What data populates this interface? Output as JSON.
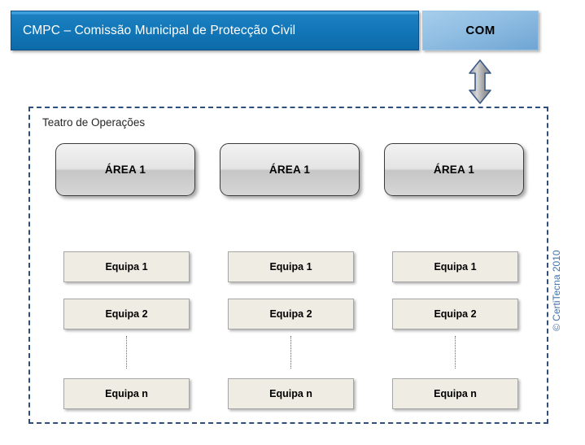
{
  "header": {
    "title_bar_label": "CMPC – Comissão Municipal de Protecção Civil",
    "com_label": "COM",
    "link_arrow_icon": "double-vertical-arrow-icon",
    "title_bar_color": "#1277b8",
    "com_color": "#8fbde2"
  },
  "theatre": {
    "label": "Teatro de Operações",
    "border_color": "#2e4f7c",
    "areas": [
      {
        "label": "ÁREA 1"
      },
      {
        "label": "ÁREA 1"
      },
      {
        "label": "ÁREA 1"
      }
    ],
    "columns": [
      {
        "teams": [
          {
            "label": "Equipa 1"
          },
          {
            "label": "Equipa 2"
          },
          {
            "label": "Equipa n"
          }
        ]
      },
      {
        "teams": [
          {
            "label": "Equipa 1"
          },
          {
            "label": "Equipa 2"
          },
          {
            "label": "Equipa n"
          }
        ]
      },
      {
        "teams": [
          {
            "label": "Equipa 1"
          },
          {
            "label": "Equipa 2"
          },
          {
            "label": "Equipa n"
          }
        ]
      }
    ]
  },
  "footer": {
    "copyright": "© CertiTecna  2010",
    "copyright_color": "#4472a8"
  }
}
